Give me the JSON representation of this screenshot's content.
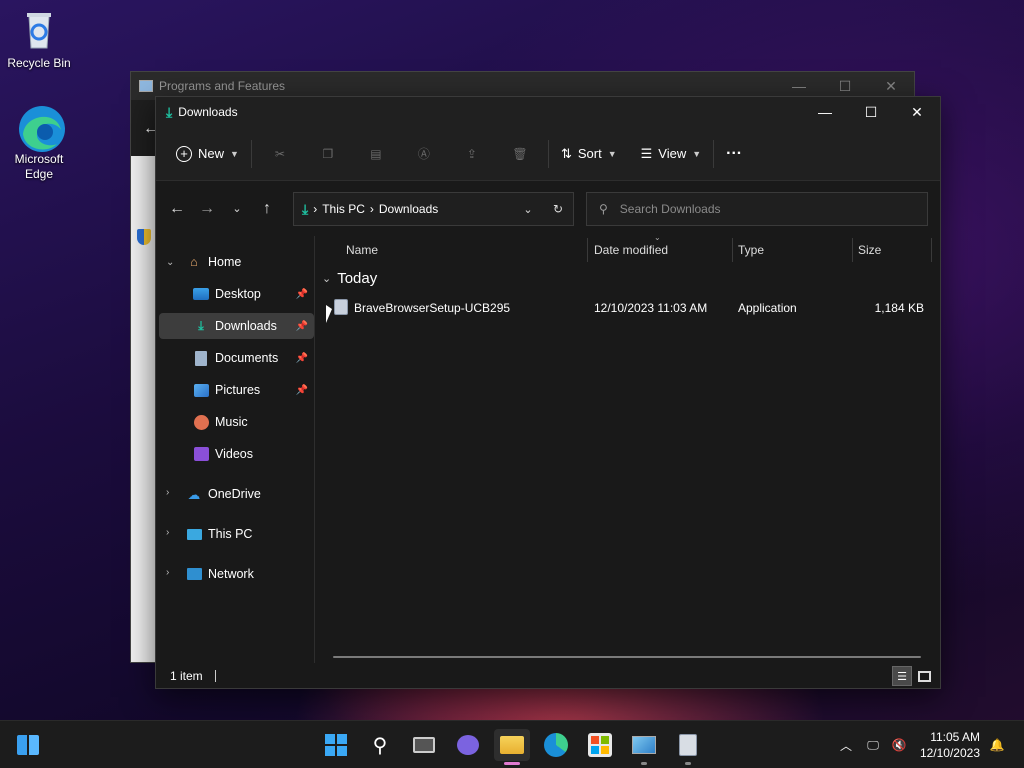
{
  "desktop": {
    "icons": [
      {
        "label": "Recycle Bin"
      },
      {
        "label": "Microsoft Edge"
      }
    ]
  },
  "bg_window": {
    "title": "Programs and Features"
  },
  "explorer": {
    "title": "Downloads",
    "toolbar": {
      "new_label": "New",
      "sort_label": "Sort",
      "view_label": "View",
      "more_label": "···"
    },
    "address": {
      "root": "This PC",
      "current": "Downloads"
    },
    "search": {
      "placeholder": "Search Downloads"
    },
    "sidebar": {
      "home": "Home",
      "items": [
        {
          "label": "Desktop",
          "pinned": true
        },
        {
          "label": "Downloads",
          "pinned": true,
          "selected": true
        },
        {
          "label": "Documents",
          "pinned": true
        },
        {
          "label": "Pictures",
          "pinned": true
        },
        {
          "label": "Music"
        },
        {
          "label": "Videos"
        }
      ],
      "onedrive": "OneDrive",
      "thispc": "This PC",
      "network": "Network"
    },
    "columns": {
      "name": "Name",
      "date": "Date modified",
      "type": "Type",
      "size": "Size"
    },
    "group": "Today",
    "files": [
      {
        "name": "BraveBrowserSetup-UCB295",
        "date": "12/10/2023 11:03 AM",
        "type": "Application",
        "size": "1,184 KB"
      }
    ],
    "status": "1 item"
  },
  "taskbar": {
    "clock": {
      "time": "11:05 AM",
      "date": "12/10/2023"
    }
  },
  "colors": {
    "accent": "#1ec0a0",
    "folder": "#f4c542",
    "selection": "#3d3d3d"
  }
}
